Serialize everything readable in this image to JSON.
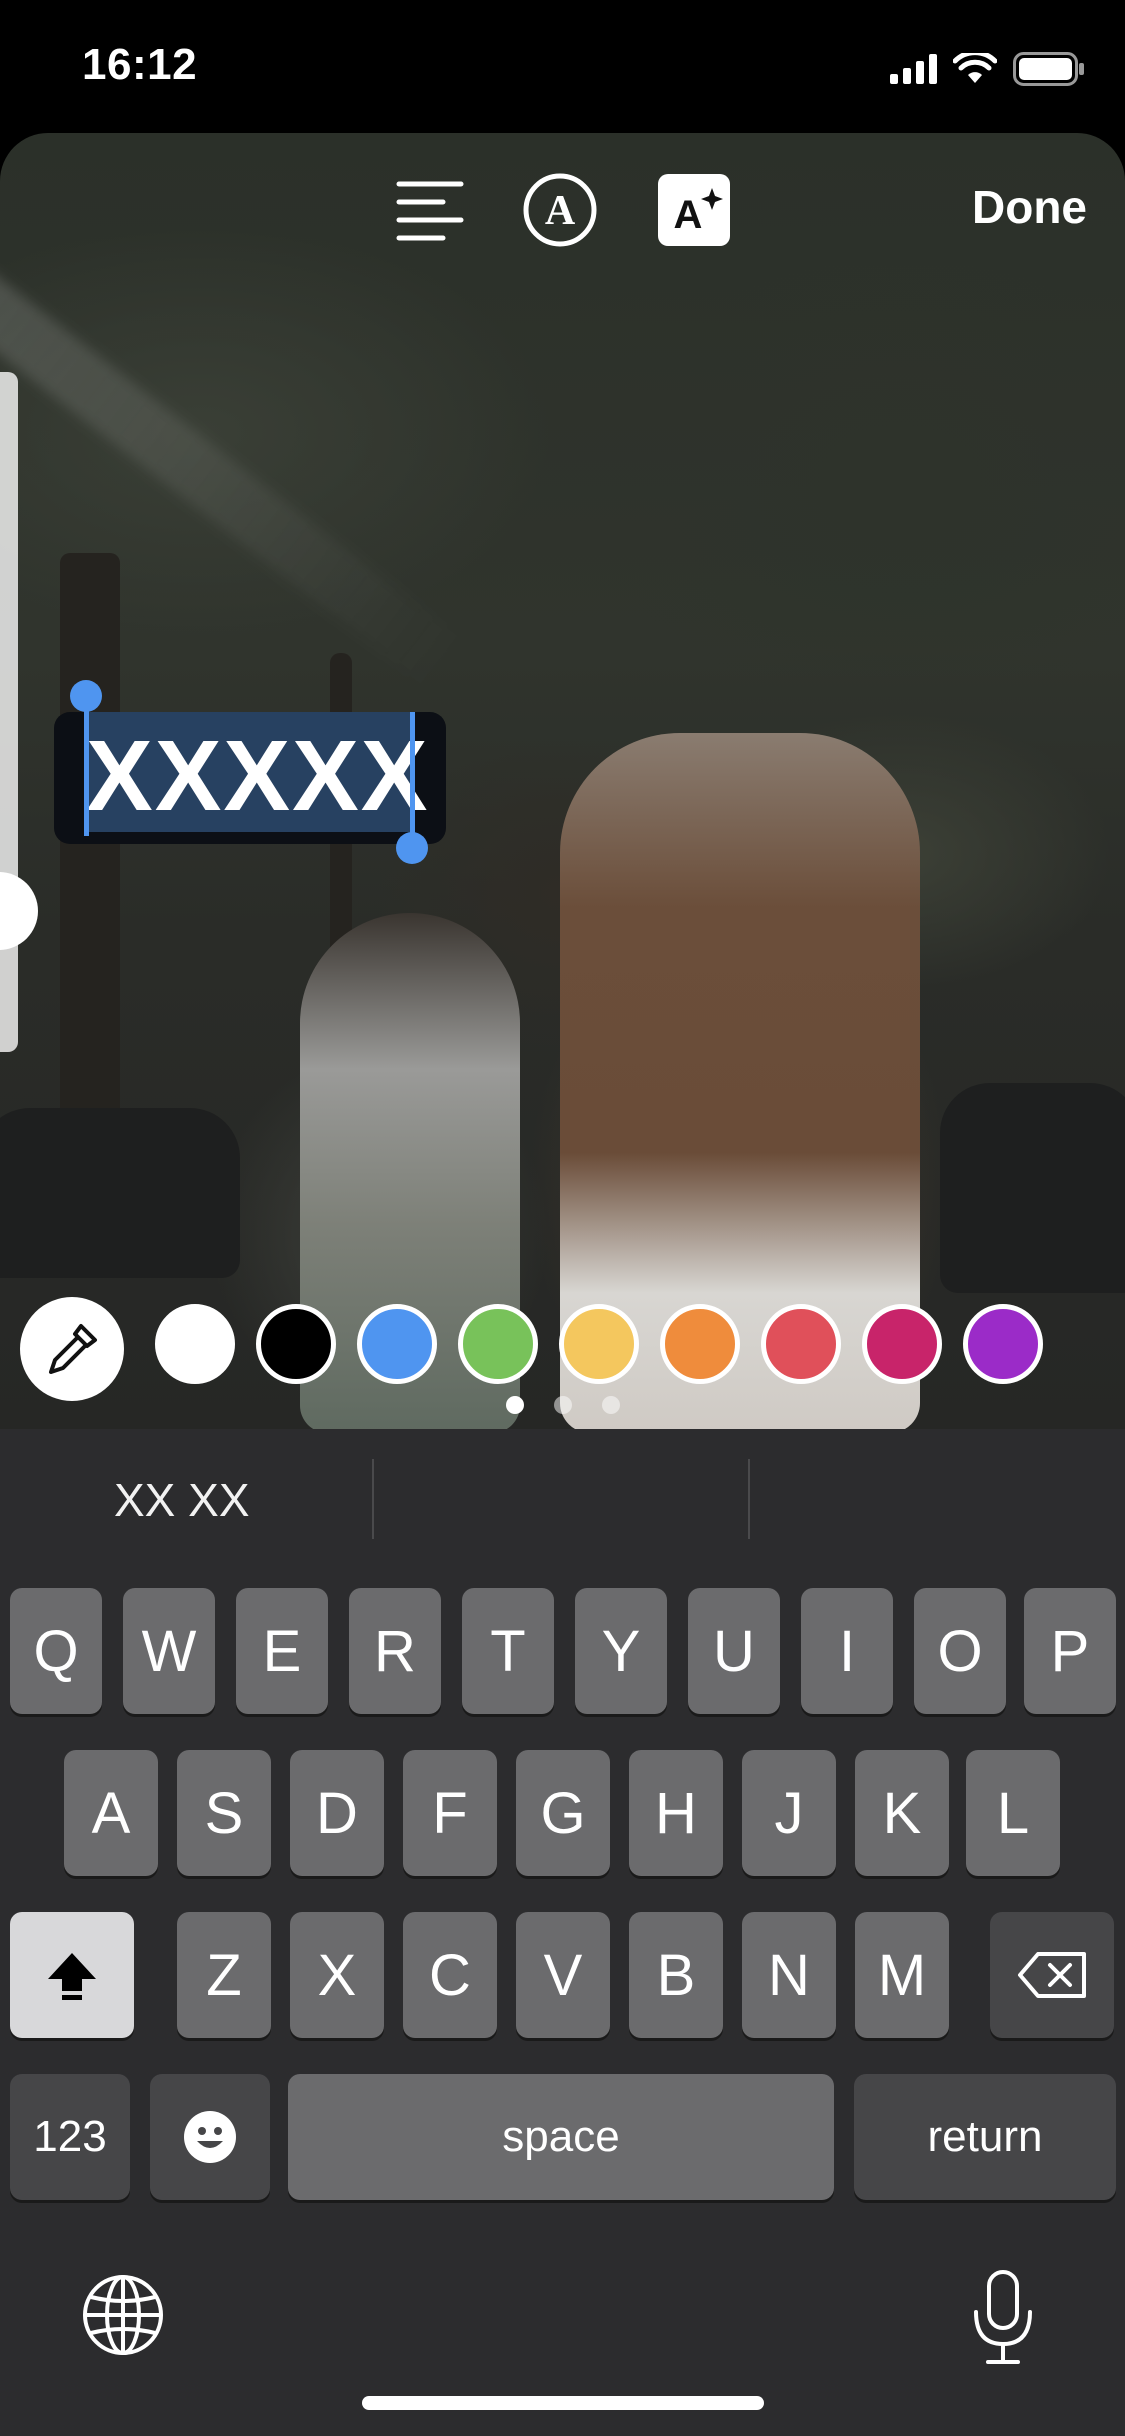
{
  "status_bar": {
    "time": "16:12",
    "icons": [
      "cellular-signal-icon",
      "wifi-icon",
      "battery-icon"
    ]
  },
  "toolbar": {
    "icons": [
      "text-align-icon",
      "text-style-a-circle-icon",
      "text-effects-sparkle-icon"
    ],
    "done_label": "Done"
  },
  "text_editor": {
    "value": "XXXXX",
    "selection_color": "#4f95f0",
    "background_color": "#0c0f15"
  },
  "color_palette": {
    "eyedropper_icon": "eyedropper-icon",
    "colors": [
      "#ffffff",
      "#000000",
      "#4f95f0",
      "#78c25a",
      "#f4c75e",
      "#ef8c3c",
      "#e0505a",
      "#c8246a",
      "#9b2bc8"
    ],
    "page_count": 3,
    "active_page": 1
  },
  "keyboard": {
    "suggestions": [
      "XX XX",
      "",
      ""
    ],
    "row1": [
      "Q",
      "W",
      "E",
      "R",
      "T",
      "Y",
      "U",
      "I",
      "O",
      "P"
    ],
    "row2": [
      "A",
      "S",
      "D",
      "F",
      "G",
      "H",
      "J",
      "K",
      "L"
    ],
    "row3": [
      "Z",
      "X",
      "C",
      "V",
      "B",
      "N",
      "M"
    ],
    "numbers_label": "123",
    "space_label": "space",
    "return_label": "return",
    "icons": [
      "shift-icon",
      "backspace-icon",
      "emoji-icon",
      "globe-icon",
      "microphone-icon"
    ]
  }
}
